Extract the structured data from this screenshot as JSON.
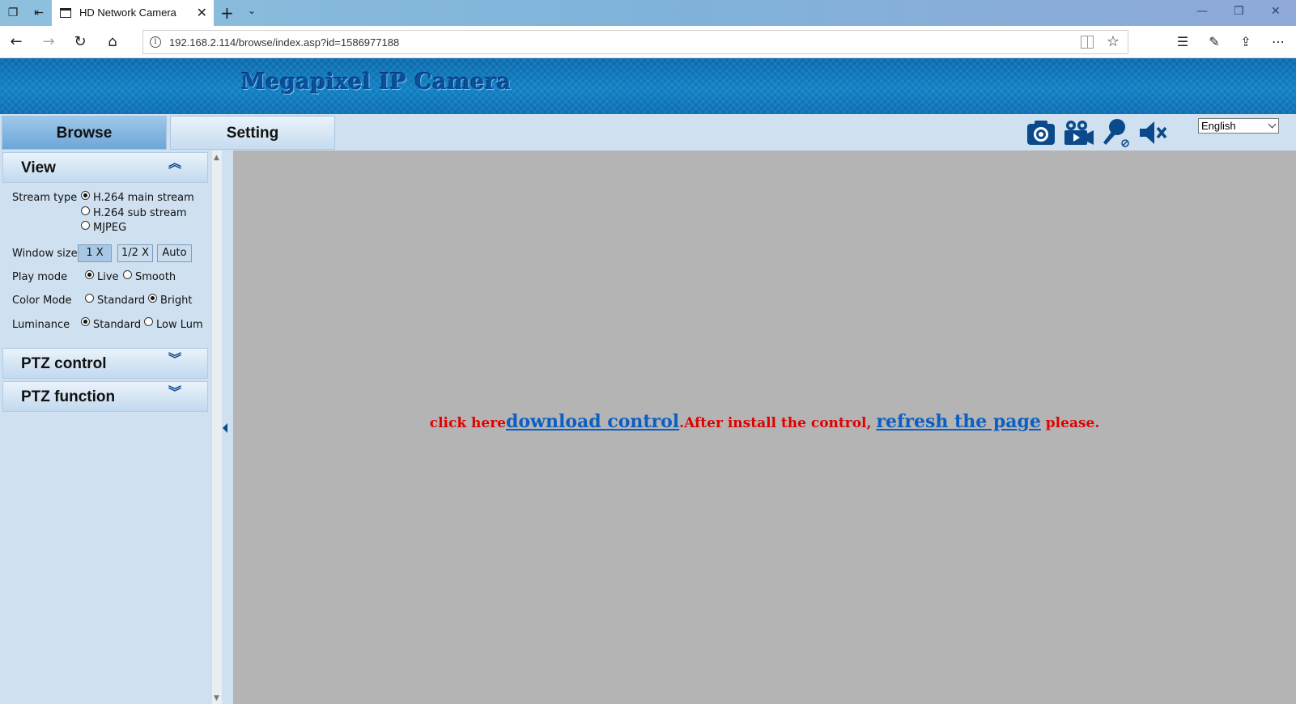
{
  "browser": {
    "tab_title": "HD Network Camera",
    "url": "192.168.2.114/browse/index.asp?id=1586977188"
  },
  "banner": {
    "title": "Megapixel IP Camera"
  },
  "menu": {
    "browse_label": "Browse",
    "setting_label": "Setting",
    "language": "English",
    "tools": [
      "camera-snapshot-icon",
      "video-record-icon",
      "microphone-icon",
      "speaker-mute-icon"
    ]
  },
  "view": {
    "title": "View",
    "stream_type": {
      "label": "Stream type",
      "options": [
        "H.264 main stream",
        "H.264 sub stream",
        "MJPEG"
      ],
      "selected": "H.264 main stream"
    },
    "window_size": {
      "label": "Window size",
      "options": [
        "1 X",
        "1/2 X",
        "Auto"
      ]
    },
    "play_mode": {
      "label": "Play mode",
      "options": [
        "Live",
        "Smooth"
      ],
      "selected": "Live"
    },
    "color_mode": {
      "label": "Color Mode",
      "options": [
        "Standard",
        "Bright"
      ],
      "selected": "Bright"
    },
    "luminance": {
      "label": "Luminance",
      "options": [
        "Standard",
        "Low Lum"
      ],
      "selected": "Standard"
    }
  },
  "ptz_control": {
    "title": "PTZ control"
  },
  "ptz_function": {
    "title": "PTZ function"
  },
  "notice": {
    "prefix": "click here",
    "download_link": "download control",
    "middle": ".After install the control, ",
    "refresh_link": "refresh the page",
    "suffix": " please."
  },
  "colors": {
    "banner": "#0f7fc2",
    "video_bg": "#b4b4b4",
    "notice_red": "#e00000",
    "link_blue": "#0b5fc4",
    "panel_bg": "#cfe0f0"
  }
}
